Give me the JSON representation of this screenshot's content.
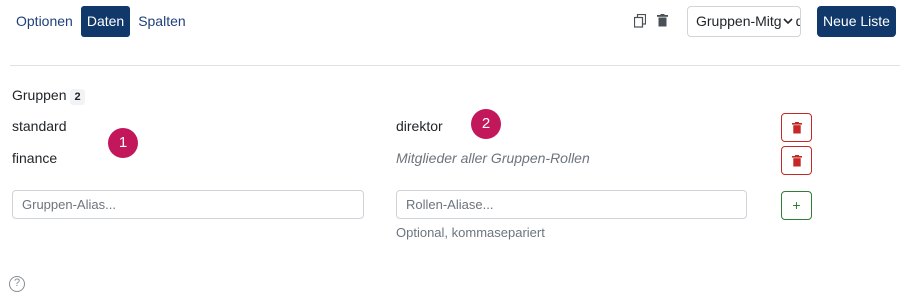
{
  "tabs": [
    {
      "label": "Optionen",
      "active": false
    },
    {
      "label": "Daten",
      "active": true
    },
    {
      "label": "Spalten",
      "active": false
    }
  ],
  "toolbar": {
    "copy_icon": "copy-icon",
    "delete_icon": "trash-icon",
    "select_value": "Gruppen-Mitglieder",
    "new_list_label": "Neue Liste"
  },
  "groups": {
    "title": "Gruppen",
    "count": "2",
    "rows": [
      {
        "alias": "standard",
        "roles": "direktor",
        "roles_is_hint": false
      },
      {
        "alias": "finance",
        "roles": "Mitglieder aller Gruppen-Rollen",
        "roles_is_hint": true
      }
    ],
    "alias_placeholder": "Gruppen-Alias...",
    "roles_placeholder": "Rollen-Aliase...",
    "roles_help": "Optional, kommasepariert",
    "add_label": "+"
  },
  "markers": [
    "1",
    "2"
  ],
  "colors": {
    "primary": "#10386b",
    "danger": "#c62828",
    "success": "#2e7d32",
    "marker": "#c2185b"
  }
}
